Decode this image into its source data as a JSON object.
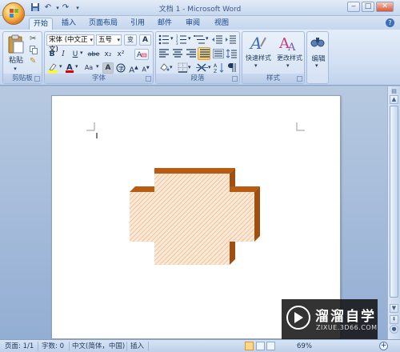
{
  "window": {
    "title": "文档 1 - Microsoft Word",
    "quick_access": [
      "save-icon",
      "undo-icon",
      "redo-icon",
      "customize-icon"
    ]
  },
  "tabs": [
    {
      "label": "开始",
      "active": true
    },
    {
      "label": "插入",
      "active": false
    },
    {
      "label": "页面布局",
      "active": false
    },
    {
      "label": "引用",
      "active": false
    },
    {
      "label": "邮件",
      "active": false
    },
    {
      "label": "审阅",
      "active": false
    },
    {
      "label": "视图",
      "active": false
    }
  ],
  "ribbon": {
    "clipboard": {
      "group_label": "剪贴板",
      "paste_label": "粘贴"
    },
    "font": {
      "group_label": "字体",
      "font_name": "宋体 (中文正文)",
      "font_size": "五号",
      "bold": "B",
      "italic": "I",
      "underline": "U",
      "strike": "abe",
      "subscript": "x₂",
      "superscript": "x²",
      "change_case": "Aa",
      "grow": "A",
      "shrink": "A"
    },
    "paragraph": {
      "group_label": "段落"
    },
    "styles": {
      "group_label": "样式",
      "quick_styles_label": "快速样式",
      "change_styles_label": "更改样式"
    },
    "editing": {
      "label": "编辑"
    }
  },
  "statusbar": {
    "page": "页面: 1/1",
    "words": "字数: 0",
    "language": "中文(简体，中国)",
    "mode": "插入",
    "zoom": "69%"
  },
  "watermark": {
    "title": "溜溜自学",
    "url": "ZIXUE.3D66.COM"
  },
  "colors": {
    "shape_fill": "#f6dcc2",
    "shape_hatch": "#e7a877",
    "shape_side": "#b85c14",
    "ribbon": "#d7e4f4"
  }
}
